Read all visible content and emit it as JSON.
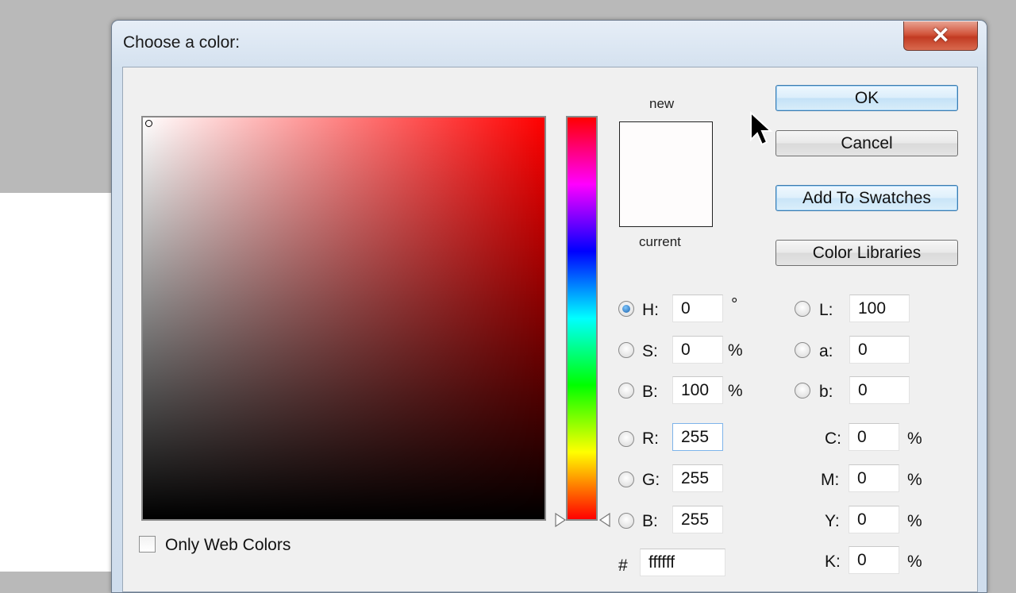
{
  "window": {
    "title": "Choose a color:",
    "close_icon": "close-icon"
  },
  "preview": {
    "new_label": "new",
    "current_label": "current",
    "new_color": "#fefcfc",
    "current_color": "#fefcfc"
  },
  "buttons": {
    "ok": "OK",
    "cancel": "Cancel",
    "add_to_swatches": "Add To Swatches",
    "color_libraries": "Color Libraries"
  },
  "hsb": {
    "h": {
      "label": "H:",
      "value": "0",
      "unit": "°",
      "selected": true
    },
    "s": {
      "label": "S:",
      "value": "0",
      "unit": "%"
    },
    "b": {
      "label": "B:",
      "value": "100",
      "unit": "%"
    }
  },
  "rgb": {
    "r": {
      "label": "R:",
      "value": "255"
    },
    "g": {
      "label": "G:",
      "value": "255"
    },
    "b": {
      "label": "B:",
      "value": "255"
    }
  },
  "lab": {
    "l": {
      "label": "L:",
      "value": "100"
    },
    "a": {
      "label": "a:",
      "value": "0"
    },
    "b": {
      "label": "b:",
      "value": "0"
    }
  },
  "cmyk": {
    "c": {
      "label": "C:",
      "value": "0",
      "unit": "%"
    },
    "m": {
      "label": "M:",
      "value": "0",
      "unit": "%"
    },
    "y": {
      "label": "Y:",
      "value": "0",
      "unit": "%"
    },
    "k": {
      "label": "K:",
      "value": "0",
      "unit": "%"
    }
  },
  "hex": {
    "label": "#",
    "value": "ffffff"
  },
  "web_colors": {
    "label": "Only Web Colors",
    "checked": false
  },
  "colors": {
    "hue_base": "#ff0000",
    "accent": "#3d7bad",
    "close_red": "#c23a22"
  }
}
